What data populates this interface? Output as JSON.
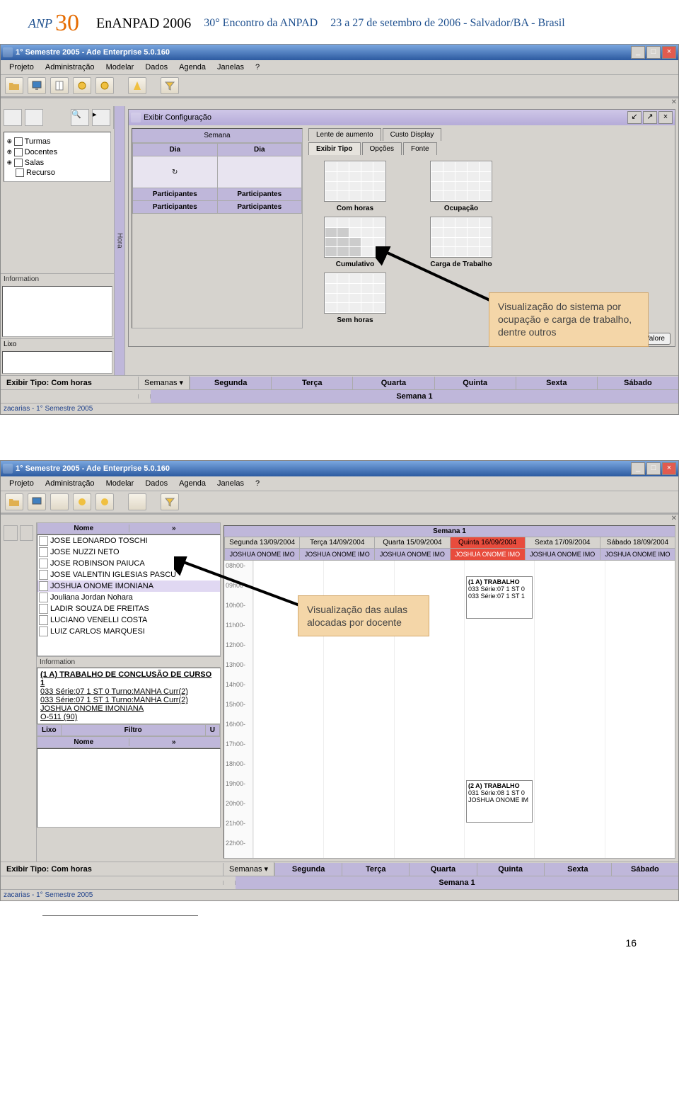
{
  "doc_header": {
    "logo_text": "ANP",
    "thirty": "30",
    "enanpad": "EnANPAD 2006",
    "encontro": "30° Encontro da ANPAD",
    "dates": "23 a 27 de setembro de 2006 - Salvador/BA - Brasil"
  },
  "app1": {
    "title": "1° Semestre 2005 - Ade Enterprise 5.0.160",
    "menu": [
      "Projeto",
      "Administração",
      "Modelar",
      "Dados",
      "Agenda",
      "Janelas",
      "?"
    ],
    "tree": [
      "Turmas",
      "Docentes",
      "Salas",
      "Recurso"
    ],
    "information": "Information",
    "hora": "Hora",
    "lixo": "Lixo",
    "config_title": "Exibir Configuração",
    "semana": "Semana",
    "dia": "Dia",
    "participantes": "Participantes",
    "tabs_top": [
      "Lente de aumento",
      "Custo Display"
    ],
    "tabs_bot": [
      "Exibir Tipo",
      "Opções",
      "Fonte"
    ],
    "thumbs": [
      "Com horas",
      "Ocupação",
      "Cumulativo",
      "Carga de Trabalho",
      "Sem horas"
    ],
    "valores": "Valore",
    "status_left": "Exibir Tipo: Com horas",
    "status_sem": "Semanas",
    "days": [
      "Segunda",
      "Terça",
      "Quarta",
      "Quinta",
      "Sexta",
      "Sábado"
    ],
    "semana1": "Semana 1",
    "bottomuser": "zacarias - 1° Semestre 2005",
    "callout": "Visualização do sistema por ocupação e carga de trabalho, dentre outros"
  },
  "app2": {
    "title": "1° Semestre 2005 - Ade Enterprise 5.0.160",
    "menu": [
      "Projeto",
      "Administração",
      "Modelar",
      "Dados",
      "Agenda",
      "Janelas",
      "?"
    ],
    "nome": "Nome",
    "names": [
      "JOSE LEONARDO TOSCHI",
      "JOSE NUZZI NETO",
      "JOSE ROBINSON PAIUCA",
      "JOSE VALENTIN IGLESIAS PASCU",
      "JOSHUA ONOME IMONIANA",
      "Jouliana Jordan Nohara",
      "LADIR SOUZA DE FREITAS",
      "LUCIANO VENELLI COSTA",
      "LUIZ CARLOS MARQUESI"
    ],
    "selected_index": 4,
    "information": "Information",
    "info_lines": [
      "(1 A) TRABALHO DE CONCLUSÃO DE CURSO 1",
      "033 Série:07 1 ST 0 Turno:MANHA Curr(2)",
      "033 Série:07 1 ST 1 Turno:MANHA Curr(2)",
      "JOSHUA ONOME IMONIANA",
      "O-511 (90)"
    ],
    "lixo": "Lixo",
    "filtro": "Filtro",
    "u": "U",
    "semana1": "Semana 1",
    "day_headers": [
      "Segunda 13/09/2004",
      "Terça 14/09/2004",
      "Quarta 15/09/2004",
      "Quinta 16/09/2004",
      "Sexta 17/09/2004",
      "Sábado 18/09/2004"
    ],
    "name_header": "JOSHUA ONOME IMO",
    "hours": [
      "08h00-",
      "09h00-",
      "10h00-",
      "11h00-",
      "12h00-",
      "13h00-",
      "14h00-",
      "15h00-",
      "16h00-",
      "17h00-",
      "18h00-",
      "19h00-",
      "20h00-",
      "21h00-",
      "22h00-"
    ],
    "event1": {
      "title": "(1 A) TRABALHO",
      "l1": "033 Série:07 1 ST 0",
      "l2": "033 Série:07 1 ST 1"
    },
    "event2": {
      "title": "(2 A) TRABALHO",
      "l1": "031 Série:08 1 ST 0",
      "l2": "JOSHUA ONOME IM"
    },
    "status_left": "Exibir Tipo: Com horas",
    "status_sem": "Semanas",
    "days": [
      "Segunda",
      "Terça",
      "Quarta",
      "Quinta",
      "Sexta",
      "Sábado"
    ],
    "bottomuser": "zacarias - 1° Semestre 2005",
    "callout": "Visualização das aulas alocadas por docente"
  },
  "page_num": "16"
}
